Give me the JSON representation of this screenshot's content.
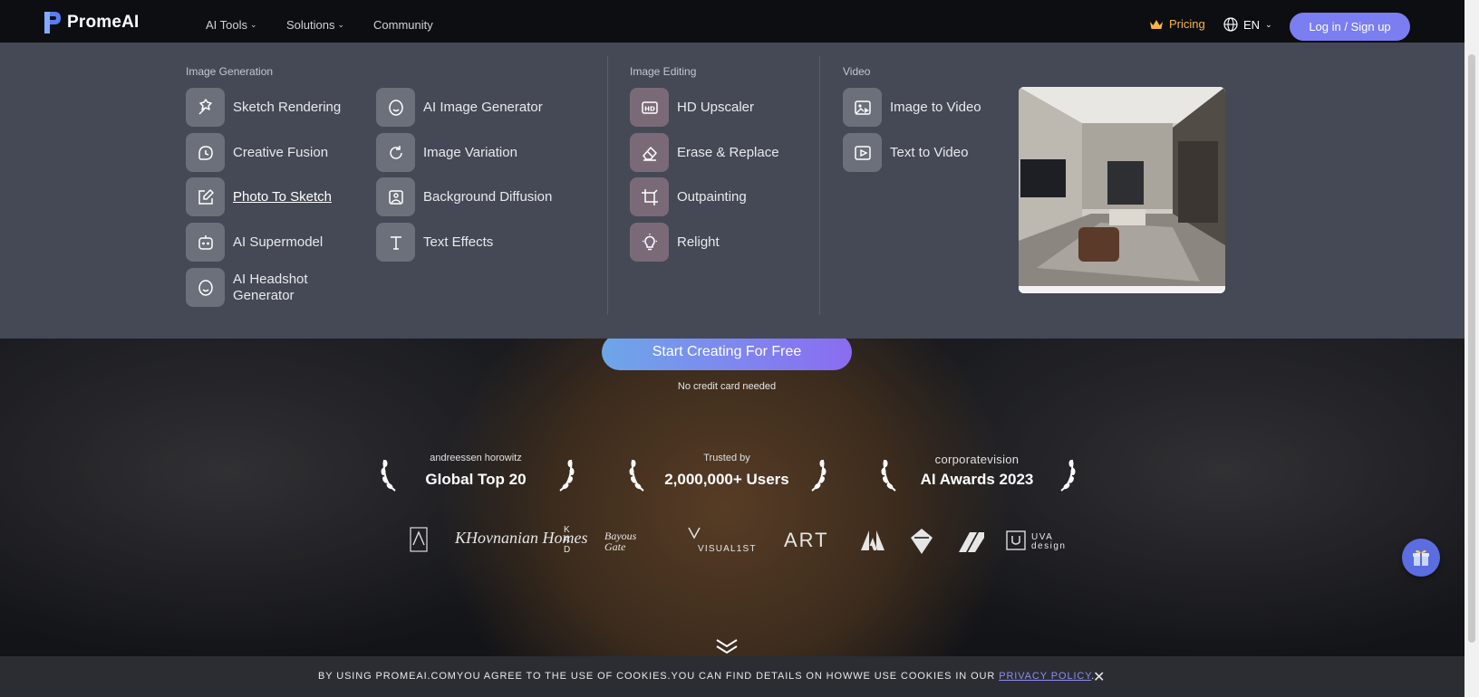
{
  "nav": {
    "logo": "PromeAI",
    "ai_tools": "AI Tools",
    "solutions": "Solutions",
    "community": "Community",
    "pricing": "Pricing",
    "lang": "EN",
    "login": "Log in / Sign up"
  },
  "menu": {
    "image_generation": {
      "title": "Image Generation",
      "col1": [
        "Sketch Rendering",
        "Creative Fusion",
        "Photo To Sketch",
        "AI Supermodel",
        "AI Headshot Generator"
      ],
      "col2": [
        "AI Image Generator",
        "Image Variation",
        "Background Diffusion",
        "Text Effects"
      ]
    },
    "image_editing": {
      "title": "Image Editing",
      "items": [
        "HD Upscaler",
        "Erase & Replace",
        "Outpainting",
        "Relight"
      ]
    },
    "video": {
      "title": "Video",
      "items": [
        "Image to Video",
        "Text to Video"
      ]
    }
  },
  "hero": {
    "cta": "Start Creating For Free",
    "no_cc": "No credit card needed"
  },
  "awards": [
    {
      "top": "andreessen horowitz",
      "main": "Global Top 20"
    },
    {
      "top": "Trusted by",
      "main": "2,000,000+ Users"
    },
    {
      "top": "corporatevision",
      "main": "AI Awards 2023"
    }
  ],
  "clients": [
    "KHovnanian Homes",
    "KAD",
    "Bayous Gate",
    "VISUAL1ST",
    "ART",
    "UVA design"
  ],
  "cookie": {
    "text": "BY USING PROMEAI.COMYOU AGREE TO THE USE OF COOKIES.YOU CAN FIND DETAILS ON HOWWE USE COOKIES IN OUR ",
    "link": "PRIVACY POLICY",
    "end": ".",
    "close": "✕"
  },
  "colors": {
    "accent": "#7b7ef0",
    "pricing": "#f5b547",
    "menu_bg": "#454955",
    "nav_bg": "#0d0e11"
  }
}
